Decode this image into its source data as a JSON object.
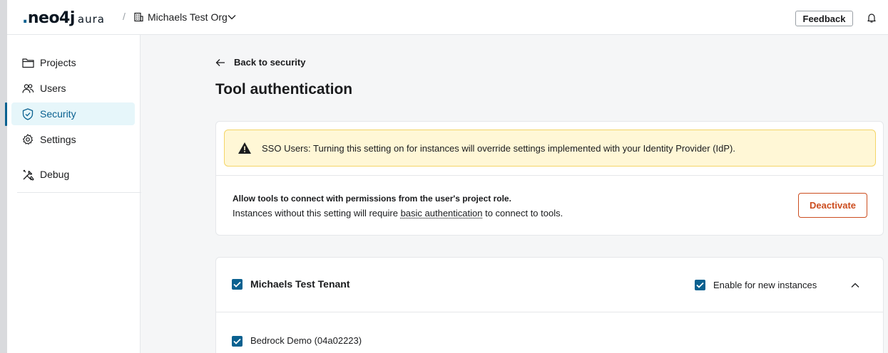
{
  "header": {
    "logo_text": "neo4j",
    "logo_product": "aura",
    "separator": "/",
    "org_name": "Michaels Test Org",
    "feedback_label": "Feedback"
  },
  "sidebar": {
    "items": [
      {
        "label": "Projects",
        "icon": "folder-icon"
      },
      {
        "label": "Users",
        "icon": "users-icon"
      },
      {
        "label": "Security",
        "icon": "shield-icon",
        "active": true
      },
      {
        "label": "Settings",
        "icon": "gear-icon"
      },
      {
        "label": "Debug",
        "icon": "tools-icon"
      }
    ]
  },
  "main": {
    "back_label": "Back to security",
    "title": "Tool authentication",
    "warning_text": "SSO Users: Turning this setting on for instances will override settings implemented with your Identity Provider (IdP).",
    "setting_title": "Allow tools to connect with permissions from the user's project role.",
    "setting_desc_before": "Instances without this setting will require ",
    "setting_desc_link": "basic authentication",
    "setting_desc_after": " to connect to tools.",
    "deactivate_label": "Deactivate",
    "tenant": {
      "name": "Michaels Test Tenant",
      "checked": true,
      "enable_new_label": "Enable for new instances",
      "enable_new_checked": true,
      "instances": [
        {
          "name": "Bedrock Demo (04a02223)",
          "checked": true
        }
      ]
    }
  },
  "colors": {
    "accent": "#0a6190",
    "active_bg": "#e6f6fa",
    "danger": "#cc4d1f",
    "warning_bg": "#fff7d6",
    "warning_border": "#f4d567"
  }
}
